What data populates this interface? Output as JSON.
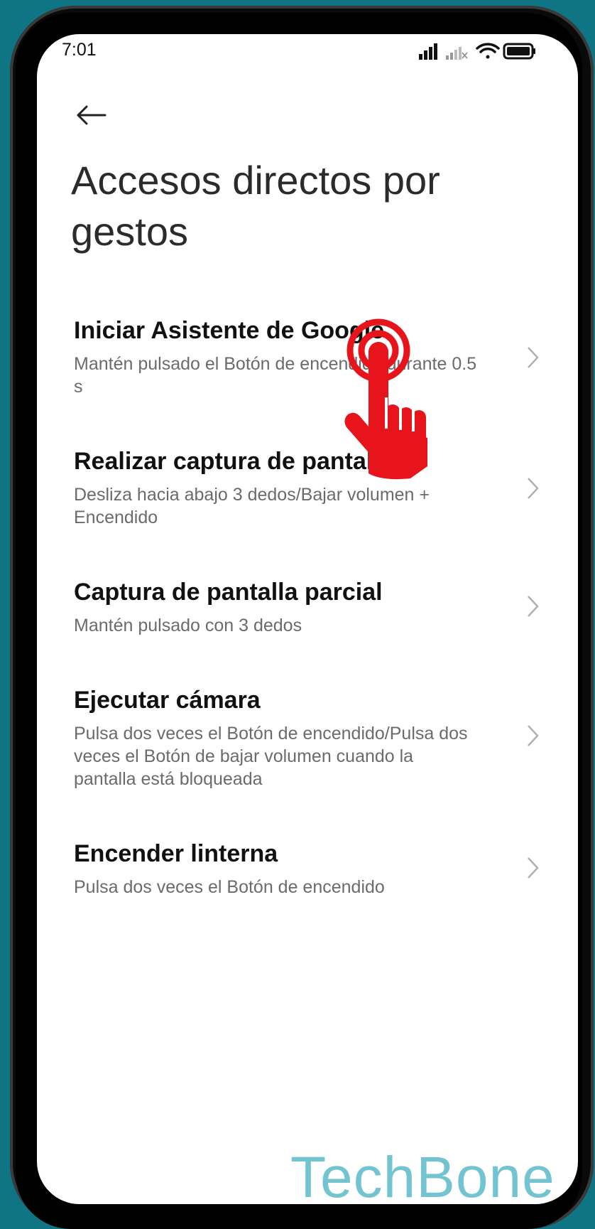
{
  "status_bar": {
    "time": "7:01",
    "icons": [
      "signal-icon",
      "signal-weak-icon",
      "wifi-icon",
      "battery-icon"
    ]
  },
  "header": {
    "back_icon": "arrow-left-icon",
    "title": "Accesos directos por gestos"
  },
  "items": [
    {
      "title": "Iniciar Asistente de Google",
      "subtitle": "Mantén pulsado el Botón de encendido durante 0.5 s"
    },
    {
      "title": "Realizar captura de pantalla",
      "subtitle": "Desliza hacia abajo 3 dedos/Bajar volumen + Encendido"
    },
    {
      "title": "Captura de pantalla parcial",
      "subtitle": "Mantén pulsado con 3 dedos"
    },
    {
      "title": "Ejecutar cámara",
      "subtitle": "Pulsa dos veces el Botón de encendido/Pulsa dos veces el Botón de bajar volumen cuando la pantalla está bloqueada"
    },
    {
      "title": "Encender linterna",
      "subtitle": "Pulsa dos veces el Botón de encendido"
    }
  ],
  "overlay": {
    "icon": "tap-hand-icon",
    "color": "#e8141b"
  },
  "watermark": "TechBone",
  "colors": {
    "background": "#0f7585",
    "watermark": "#72c4d1",
    "tap": "#e8141b"
  }
}
